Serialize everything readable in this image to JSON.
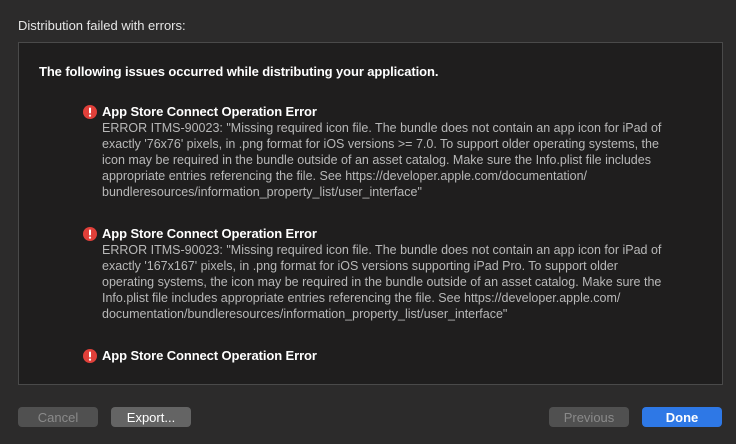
{
  "dialog": {
    "title": "Distribution failed with errors:"
  },
  "panel": {
    "summary": "The following issues occurred while distributing your application.",
    "issues": [
      {
        "title": "App Store Connect Operation Error",
        "lines": [
          "ERROR ITMS-90023: \"Missing required icon file. The bundle does not contain an app icon for iPad of",
          "exactly '76x76' pixels, in .png format for iOS versions >= 7.0. To support older operating systems, the",
          "icon may be required in the bundle outside of an asset catalog. Make sure the Info.plist file includes",
          "appropriate entries referencing the file. See https://developer.apple.com/documentation/",
          "bundleresources/information_property_list/user_interface\""
        ]
      },
      {
        "title": "App Store Connect Operation Error",
        "lines": [
          "ERROR ITMS-90023: \"Missing required icon file. The bundle does not contain an app icon for iPad of",
          "exactly '167x167' pixels, in .png format for iOS versions supporting iPad Pro. To support older",
          "operating systems, the icon may be required in the bundle outside of an asset catalog. Make sure the",
          "Info.plist file includes appropriate entries referencing the file. See https://developer.apple.com/",
          "documentation/bundleresources/information_property_list/user_interface\""
        ]
      },
      {
        "title": "App Store Connect Operation Error",
        "lines": []
      }
    ]
  },
  "buttons": {
    "cancel": "Cancel",
    "export": "Export...",
    "previous": "Previous",
    "done": "Done"
  },
  "colors": {
    "error_icon": "#e0403a",
    "accent": "#2e78e6"
  },
  "icons": {
    "error": "exclamation-circle-icon"
  }
}
